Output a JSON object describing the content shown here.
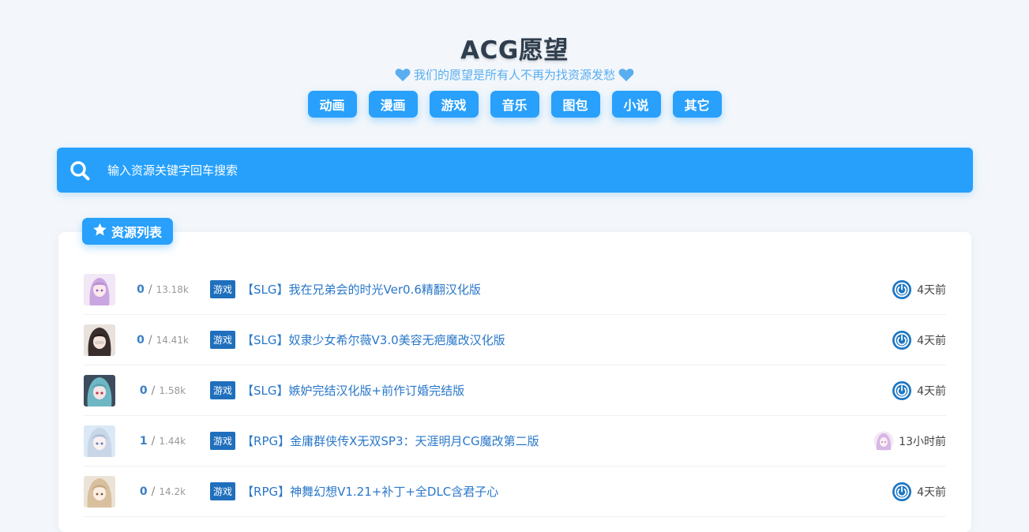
{
  "header": {
    "title": "ACG愿望",
    "tagline": "我们的愿望是所有人不再为找资源发愁"
  },
  "nav": [
    "动画",
    "漫画",
    "游戏",
    "音乐",
    "图包",
    "小说",
    "其它"
  ],
  "search": {
    "placeholder": "输入资源关键字回车搜索"
  },
  "section": {
    "label": "资源列表"
  },
  "colors": {
    "accent": "#29a0fb",
    "tag": "#1f6fbd",
    "link": "#2977c9",
    "title": "#2f3e4e"
  },
  "rows": [
    {
      "replies": "0",
      "views": "13.18k",
      "tag": "游戏",
      "title": "【SLG】我在兄弟会的时光Ver0.6精翻汉化版",
      "time": "4天前",
      "user_icon": "power-icon",
      "avatar": "purple-hair"
    },
    {
      "replies": "0",
      "views": "14.41k",
      "tag": "游戏",
      "title": "【SLG】奴隶少女希尔薇V3.0美容无疤魔改汉化版",
      "time": "4天前",
      "user_icon": "power-icon",
      "avatar": "dark-hair"
    },
    {
      "replies": "0",
      "views": "1.58k",
      "tag": "游戏",
      "title": "【SLG】嫉妒完结汉化版+前作订婚完结版",
      "time": "4天前",
      "user_icon": "power-icon",
      "avatar": "teal-hair"
    },
    {
      "replies": "1",
      "views": "1.44k",
      "tag": "游戏",
      "title": "【RPG】金庸群侠传X无双SP3：天涯明月CG魔改第二版",
      "time": "13小时前",
      "user_icon": "anime-avatar",
      "avatar": "silver-hair"
    },
    {
      "replies": "0",
      "views": "14.2k",
      "tag": "游戏",
      "title": "【RPG】神舞幻想V1.21+补丁+全DLC含君子心",
      "time": "4天前",
      "user_icon": "power-icon",
      "avatar": "blonde-hair"
    }
  ]
}
